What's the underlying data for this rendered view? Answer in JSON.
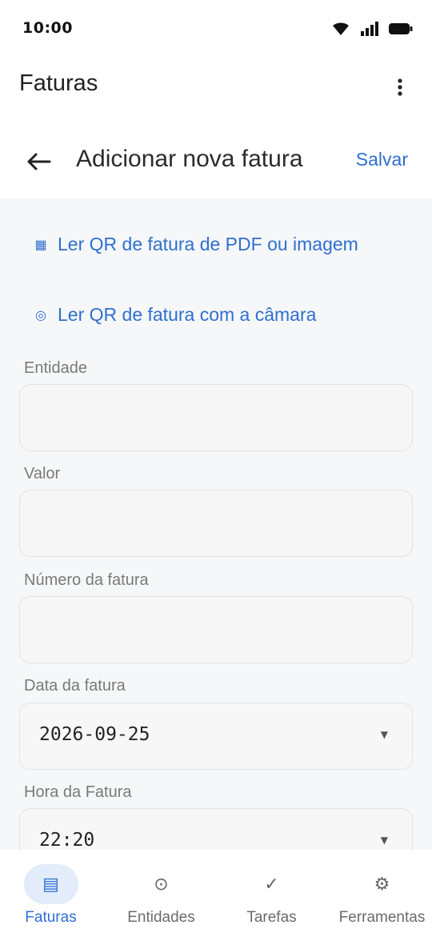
{
  "status_bar": {
    "time": "10:00"
  },
  "app_header": {
    "title": "Faturas"
  },
  "page_header": {
    "title": "Adicionar nova fatura",
    "save_label": "Salvar"
  },
  "actions": {
    "qr_file_label": "Ler QR de fatura de PDF ou imagem",
    "qr_camera_label": "Ler QR de fatura com a câmara"
  },
  "form": {
    "entity_label": "Entidade",
    "entity_value": "",
    "amount_label": "Valor",
    "amount_value": "",
    "invoice_number_label": "Número da fatura",
    "invoice_number_value": "",
    "invoice_date_label": "Data da fatura",
    "invoice_date_value": "2026-09-25",
    "invoice_time_label": "Hora da Fatura",
    "invoice_time_value": "22:20"
  },
  "bottom_nav": {
    "items": [
      {
        "label": "Faturas",
        "icon": "invoice-list-icon",
        "active": true
      },
      {
        "label": "Entidades",
        "icon": "entity-icon",
        "active": false
      },
      {
        "label": "Tarefas",
        "icon": "check-icon",
        "active": false
      },
      {
        "label": "Ferramentas",
        "icon": "settings-icon",
        "active": false
      }
    ]
  },
  "colors": {
    "accent": "#2f6fd0",
    "nav_active_bg": "#e3ecfb",
    "content_bg": "#f6f7f8"
  }
}
